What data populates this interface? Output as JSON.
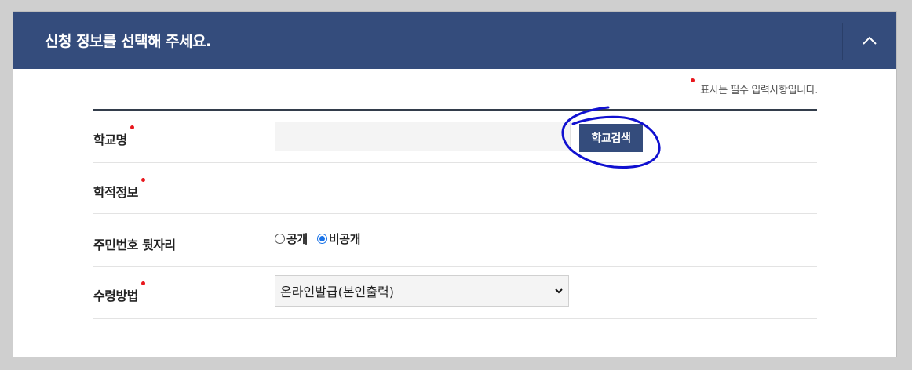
{
  "header": {
    "title": "신청 정보를 선택해 주세요.",
    "toggle_icon": "chevron-up-icon"
  },
  "required_note": "표시는 필수 입력사항입니다.",
  "colors": {
    "header_bg": "#344c7c",
    "required_dot": "#e8171d",
    "annotation": "#1010d0"
  },
  "form": {
    "school": {
      "label": "학교명",
      "required": true,
      "input_value": "",
      "button_label": "학교검색"
    },
    "academic": {
      "label": "학적정보",
      "required": true
    },
    "resident_number": {
      "label": "주민번호 뒷자리",
      "options": [
        "공개",
        "비공개"
      ],
      "selected": "비공개"
    },
    "receive_method": {
      "label": "수령방법",
      "required": true,
      "selected_value": "온라인발급(본인출력)"
    }
  }
}
